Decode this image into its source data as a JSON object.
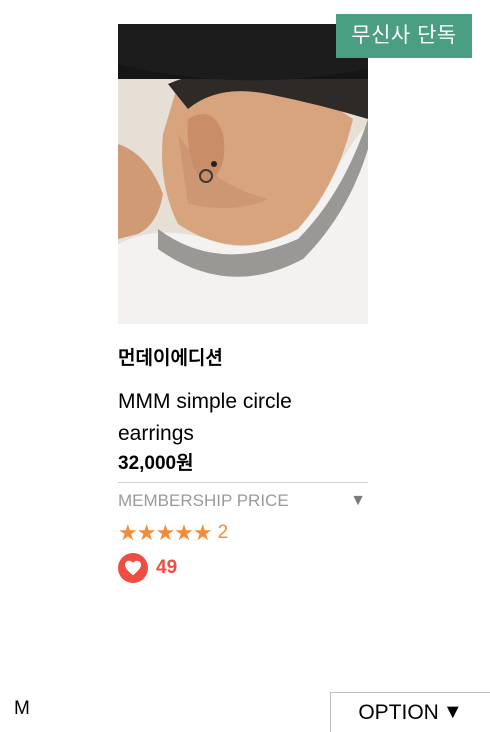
{
  "product": {
    "badge": "무신사 단독",
    "brand": "먼데이에디션",
    "name": "MMM simple circle earrings",
    "price": "32,000원",
    "membership_label": "MEMBERSHIP PRICE",
    "membership_caret": "▼",
    "stars": "★★★★★",
    "rating_count": "2",
    "like_count": "49",
    "image_icon": "product-photo"
  },
  "footer": {
    "left_text": "M",
    "option_label": "OPTION",
    "option_caret": "▼"
  },
  "colors": {
    "badge_bg": "#4a9e82",
    "star": "#f28c3a",
    "heart": "#ef4c43",
    "muted": "#9a9a9a"
  }
}
